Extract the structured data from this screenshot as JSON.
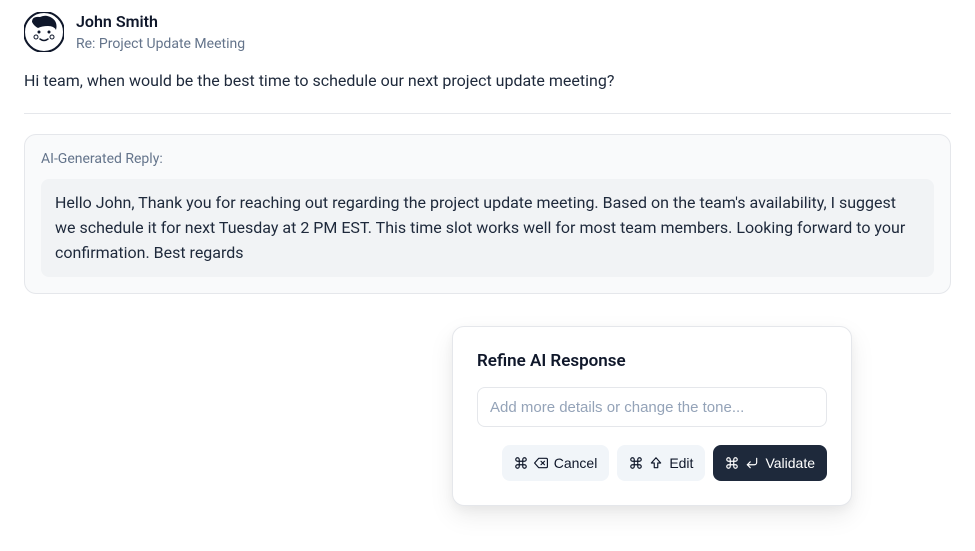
{
  "email": {
    "sender_name": "John Smith",
    "subject": "Re: Project Update Meeting",
    "body": "Hi team, when would be the best time to schedule our next project update meeting?"
  },
  "ai_reply": {
    "label": "AI-Generated Reply:",
    "content": "Hello John, Thank you for reaching out regarding the project update meeting. Based on the team's availability, I suggest we schedule it for next Tuesday at 2 PM EST. This time slot works well for most team members. Looking forward to your confirmation. Best regards"
  },
  "popover": {
    "title": "Refine AI Response",
    "input_placeholder": "Add more details or change the tone...",
    "actions": {
      "cancel_label": "Cancel",
      "edit_label": "Edit",
      "validate_label": "Validate"
    }
  }
}
